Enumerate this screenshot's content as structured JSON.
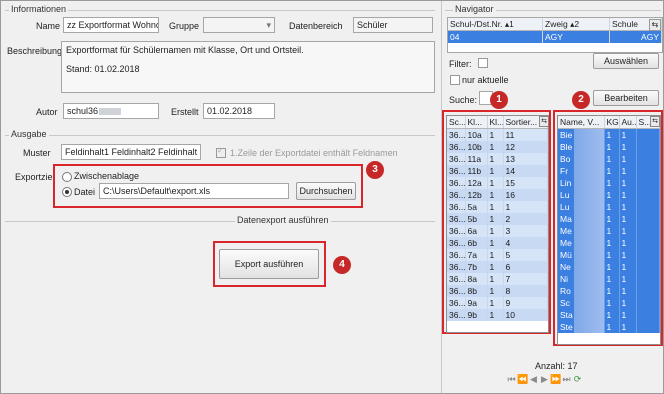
{
  "info": {
    "section_title": "Informationen",
    "name_label": "Name",
    "name_value": "zz Exportformat Wohnor",
    "gruppe_label": "Gruppe",
    "gruppe_value": "",
    "datenbereich_label": "Datenbereich",
    "datenbereich_value": "Schüler",
    "beschreibung_label": "Beschreibung",
    "beschreibung_line1": "Exportformat für Schülernamen mit Klasse, Ort und Ortsteil.",
    "beschreibung_line2": "Stand: 01.02.2018",
    "autor_label": "Autor",
    "autor_value": "schul36",
    "erstellt_label": "Erstellt",
    "erstellt_value": "01.02.2018"
  },
  "ausgabe": {
    "section_title": "Ausgabe",
    "muster_label": "Muster",
    "muster_value": "Feldinhalt1    Feldinhalt2    Feldinhalt",
    "header_checkbox_label": "1.Zeile der Exportdatei enthält Feldnamen",
    "exportziel_label": "Exportziel",
    "option_clipboard": "Zwischenablage",
    "option_file": "Datei",
    "file_path": "C:\\Users\\Default\\export.xls",
    "browse_label": "Durchsuchen"
  },
  "run": {
    "section_title": "Datenexport ausführen",
    "button_label": "Export ausführen"
  },
  "badges": [
    "1",
    "2",
    "3",
    "4"
  ],
  "navigator": {
    "title": "Navigator",
    "col_schulnr": "Schul-/Dst.Nr.",
    "col_zweig": "Zweig",
    "col_schule": "Schule",
    "row_schulnr": "04",
    "row_zweig": "AGY",
    "row_schule": "AGY",
    "filter_label": "Filter:",
    "nur_aktuelle_label": "nur aktuelle",
    "auswaehlen_label": "Auswählen",
    "suche_label": "Suche:",
    "bearbeiten_label": "Bearbeiten",
    "anzahl_label": "Anzahl: 17"
  },
  "klassen_grid": {
    "headers": [
      "Sc...",
      "Kl...",
      "Kl...",
      "Sortier..."
    ],
    "rows": [
      [
        "36...",
        "10a",
        "1",
        "11"
      ],
      [
        "36...",
        "10b",
        "1",
        "12"
      ],
      [
        "36...",
        "11a",
        "1",
        "13"
      ],
      [
        "36...",
        "11b",
        "1",
        "14"
      ],
      [
        "36...",
        "12a",
        "1",
        "15"
      ],
      [
        "36...",
        "12b",
        "1",
        "16"
      ],
      [
        "36...",
        "5a",
        "1",
        "1"
      ],
      [
        "36...",
        "5b",
        "1",
        "2"
      ],
      [
        "36...",
        "6a",
        "1",
        "3"
      ],
      [
        "36...",
        "6b",
        "1",
        "4"
      ],
      [
        "36...",
        "7a",
        "1",
        "5"
      ],
      [
        "36...",
        "7b",
        "1",
        "6"
      ],
      [
        "36...",
        "8a",
        "1",
        "7"
      ],
      [
        "36...",
        "8b",
        "1",
        "8"
      ],
      [
        "36...",
        "9a",
        "1",
        "9"
      ],
      [
        "36...",
        "9b",
        "1",
        "10"
      ]
    ]
  },
  "schueler_grid": {
    "headers": [
      "Name, V...",
      "KG",
      "Au...",
      "S..."
    ],
    "rows": [
      [
        "Bie",
        "1",
        "1",
        ""
      ],
      [
        "Ble",
        "1",
        "1",
        ""
      ],
      [
        "Bo",
        "1",
        "1",
        ""
      ],
      [
        "Fr",
        "1",
        "1",
        ""
      ],
      [
        "Lin",
        "1",
        "1",
        ""
      ],
      [
        "Lu",
        "1",
        "1",
        ""
      ],
      [
        "Lu",
        "1",
        "1",
        ""
      ],
      [
        "Ma",
        "1",
        "1",
        ""
      ],
      [
        "Me",
        "1",
        "1",
        ""
      ],
      [
        "Me",
        "1",
        "1",
        ""
      ],
      [
        "Mü",
        "1",
        "1",
        ""
      ],
      [
        "Ne",
        "1",
        "1",
        ""
      ],
      [
        "Ni",
        "1",
        "1",
        ""
      ],
      [
        "Ro",
        "1",
        "1",
        ""
      ],
      [
        "Sc",
        "1",
        "1",
        ""
      ],
      [
        "Sta",
        "1",
        "1",
        ""
      ],
      [
        "Ste",
        "1",
        "1",
        ""
      ]
    ]
  },
  "colors": {
    "accent_red": "#d9262b",
    "selection_blue": "#3b7fe0",
    "badge_red": "#c62828"
  }
}
